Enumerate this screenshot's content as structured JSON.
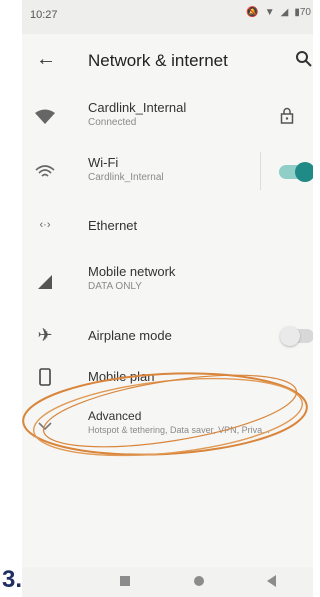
{
  "status": {
    "time": "10:27",
    "battery": "70"
  },
  "header": {
    "title": "Network & internet"
  },
  "items": [
    {
      "label": "Cardlink_Internal",
      "sub": "Connected"
    },
    {
      "label": "Wi-Fi",
      "sub": "Cardlink_Internal"
    },
    {
      "label": "Ethernet",
      "sub": ""
    },
    {
      "label": "Mobile network",
      "sub": "DATA ONLY"
    },
    {
      "label": "Airplane mode",
      "sub": ""
    },
    {
      "label": "Mobile plan",
      "sub": ""
    },
    {
      "label": "Advanced",
      "sub": "Hotspot & tethering, Data saver, VPN, Priva..."
    }
  ],
  "toggles": {
    "wifi_on": true,
    "airplane_on": false
  },
  "colors": {
    "accent": "#1f8a86",
    "annotation": "#d9853b"
  },
  "side_label": "3."
}
